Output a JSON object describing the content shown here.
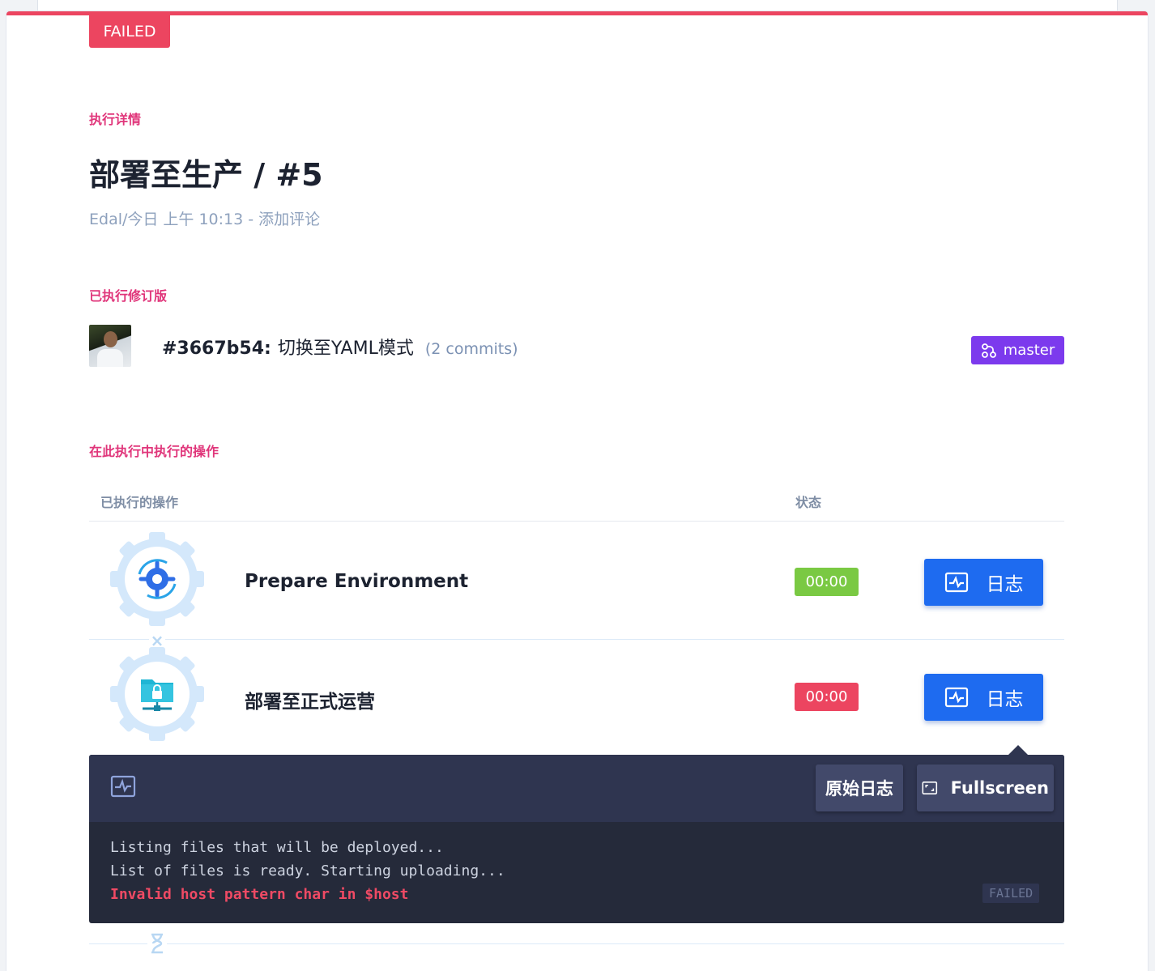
{
  "status_tab": "FAILED",
  "sections": {
    "details": "执行详情",
    "revision": "已执行修订版",
    "operations": "在此执行中执行的操作"
  },
  "title": "部署至生产 / #5",
  "meta": "Edal/今日 上午 10:13 - 添加评论",
  "commit": {
    "hash": "#3667b54:",
    "message": "切换至YAML模式",
    "count": "(2 commits)"
  },
  "branch": {
    "label": "master",
    "icon": "branch-icon"
  },
  "table": {
    "headers": [
      "已执行的操作",
      "状态"
    ]
  },
  "steps": [
    {
      "name": "Prepare Environment",
      "time": "00:00",
      "status": "success",
      "icon": "gear-sync-icon",
      "button": "日志"
    },
    {
      "name": "部署至正式运营",
      "time": "00:00",
      "status": "failed",
      "icon": "network-folder-icon",
      "button": "日志"
    }
  ],
  "log": {
    "raw_button": "原始日志",
    "fullscreen_button": "Fullscreen",
    "lines": [
      "Listing files that will be deployed...",
      "List of files is ready. Starting uploading..."
    ],
    "error_line": "Invalid host pattern char in $host",
    "status": "FAILED"
  },
  "colors": {
    "failed": "#ec4560",
    "success": "#7ac943",
    "primary": "#1e6bf0",
    "branch": "#7c3aed",
    "accent_label": "#e0357a"
  }
}
